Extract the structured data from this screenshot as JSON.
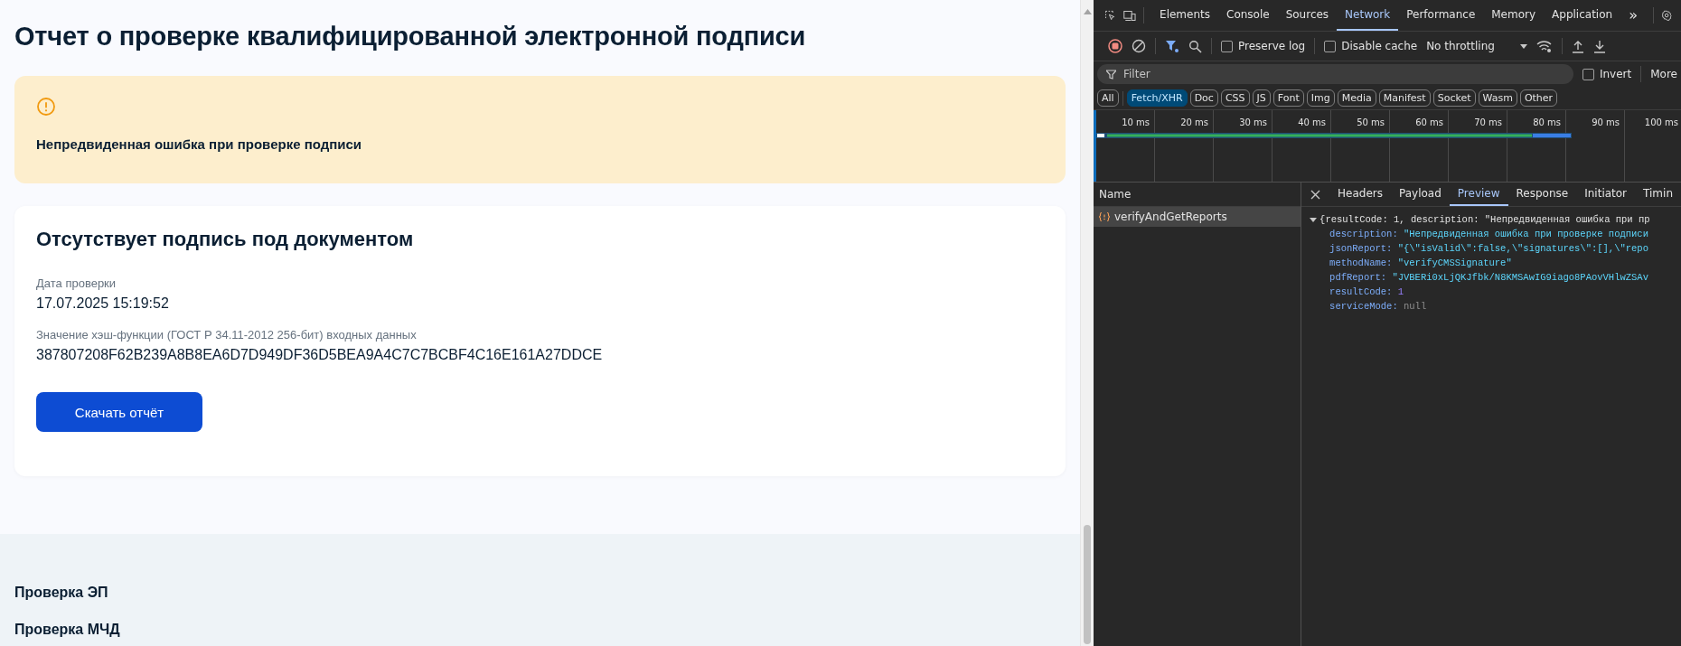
{
  "page": {
    "title": "Отчет о проверке квалифицированной электронной подписи",
    "alert": {
      "message": "Непредвиденная ошибка при проверке подписи"
    },
    "card": {
      "heading": "Отсутствует подпись под документом",
      "fields": [
        {
          "label": "Дата проверки",
          "value": "17.07.2025 15:19:52"
        },
        {
          "label": "Значение хэш-функции (ГОСТ Р 34.11-2012 256-бит) входных данных",
          "value": "387807208F62B239A8B8EA6D7D949DF36D5BEA9A4C7C7BCBF4C16E161A27DDCE"
        }
      ],
      "button": "Скачать отчёт"
    },
    "footer_links": [
      "Проверка ЭП",
      "Проверка МЧД"
    ]
  },
  "devtools": {
    "tabs": [
      {
        "label": "Elements",
        "selected": false
      },
      {
        "label": "Console",
        "selected": false
      },
      {
        "label": "Sources",
        "selected": false
      },
      {
        "label": "Network",
        "selected": true
      },
      {
        "label": "Performance",
        "selected": false
      },
      {
        "label": "Memory",
        "selected": false
      },
      {
        "label": "Application",
        "selected": false
      }
    ],
    "overflow": "»",
    "toolbar": {
      "recording": true,
      "preserve_log": {
        "label": "Preserve log",
        "checked": false
      },
      "disable_cache": {
        "label": "Disable cache",
        "checked": false
      },
      "throttling": "No throttling"
    },
    "filter": {
      "placeholder": "Filter",
      "invert": {
        "label": "Invert",
        "checked": false
      },
      "more": "More"
    },
    "type_filters": [
      {
        "label": "All",
        "selected": false
      },
      {
        "label": "Fetch/XHR",
        "selected": true
      },
      {
        "label": "Doc",
        "selected": false
      },
      {
        "label": "CSS",
        "selected": false
      },
      {
        "label": "JS",
        "selected": false
      },
      {
        "label": "Font",
        "selected": false
      },
      {
        "label": "Img",
        "selected": false
      },
      {
        "label": "Media",
        "selected": false
      },
      {
        "label": "Manifest",
        "selected": false
      },
      {
        "label": "Socket",
        "selected": false
      },
      {
        "label": "Wasm",
        "selected": false
      },
      {
        "label": "Other",
        "selected": false
      }
    ],
    "timeline_ticks": [
      "10 ms",
      "20 ms",
      "30 ms",
      "40 ms",
      "50 ms",
      "60 ms",
      "70 ms",
      "80 ms",
      "90 ms",
      "100 ms"
    ],
    "requests": {
      "column": "Name",
      "rows": [
        {
          "name": "verifyAndGetReports",
          "selected": true
        }
      ]
    },
    "detail_tabs": [
      {
        "label": "Headers",
        "selected": false
      },
      {
        "label": "Payload",
        "selected": false
      },
      {
        "label": "Preview",
        "selected": true
      },
      {
        "label": "Response",
        "selected": false
      },
      {
        "label": "Initiator",
        "selected": false
      },
      {
        "label": "Timin",
        "selected": false
      }
    ],
    "preview": {
      "summary": "{resultCode: 1, description: \"Непредвиденная ошибка при пр",
      "properties": [
        {
          "key": "description:",
          "value": "\"Непредвиденная ошибка при проверке подписи",
          "kind": "string"
        },
        {
          "key": "jsonReport:",
          "value": "\"{\\\"isValid\\\":false,\\\"signatures\\\":[],\\\"repo",
          "kind": "string"
        },
        {
          "key": "methodName:",
          "value": "\"verifyCMSSignature\"",
          "kind": "string"
        },
        {
          "key": "pdfReport:",
          "value": "\"JVBERi0xLjQKJfbk/N8KMSAwIG9iago8PAovVHlwZSAv",
          "kind": "string"
        },
        {
          "key": "resultCode:",
          "value": "1",
          "kind": "number"
        },
        {
          "key": "serviceMode:",
          "value": "null",
          "kind": "null"
        }
      ]
    }
  }
}
